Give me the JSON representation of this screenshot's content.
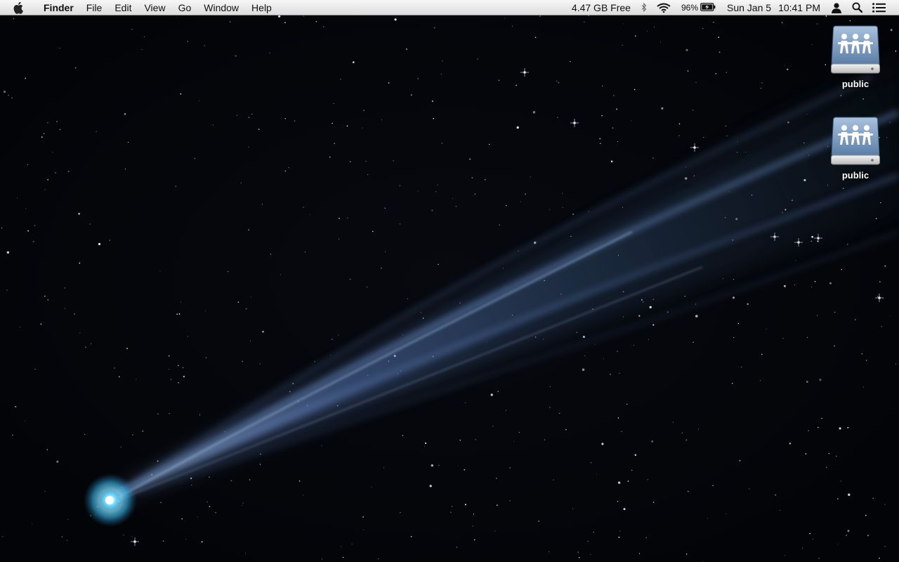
{
  "menubar": {
    "app_name": "Finder",
    "menus": [
      "File",
      "Edit",
      "View",
      "Go",
      "Window",
      "Help"
    ],
    "status": {
      "disk_free": "4.47 GB Free",
      "battery_percent": "96%",
      "date": "Sun Jan 5",
      "time": "10:41 PM"
    },
    "icons": {
      "apple": "apple-icon",
      "bluetooth": "bluetooth-icon",
      "wifi": "wifi-icon",
      "battery": "battery-charging-icon",
      "user": "user-icon",
      "spotlight": "search-icon",
      "notifications": "notification-center-icon"
    }
  },
  "desktop": {
    "wallpaper": "comet-starfield",
    "icons": [
      {
        "label": "public",
        "icon": "shared-drive-icon"
      },
      {
        "label": "public",
        "icon": "shared-drive-icon"
      }
    ]
  },
  "colors": {
    "menubar_bg": "#e8e8e8",
    "comet_glow": "#7fdcff",
    "comet_tail": "#4a6fae",
    "space": "#04060a"
  }
}
